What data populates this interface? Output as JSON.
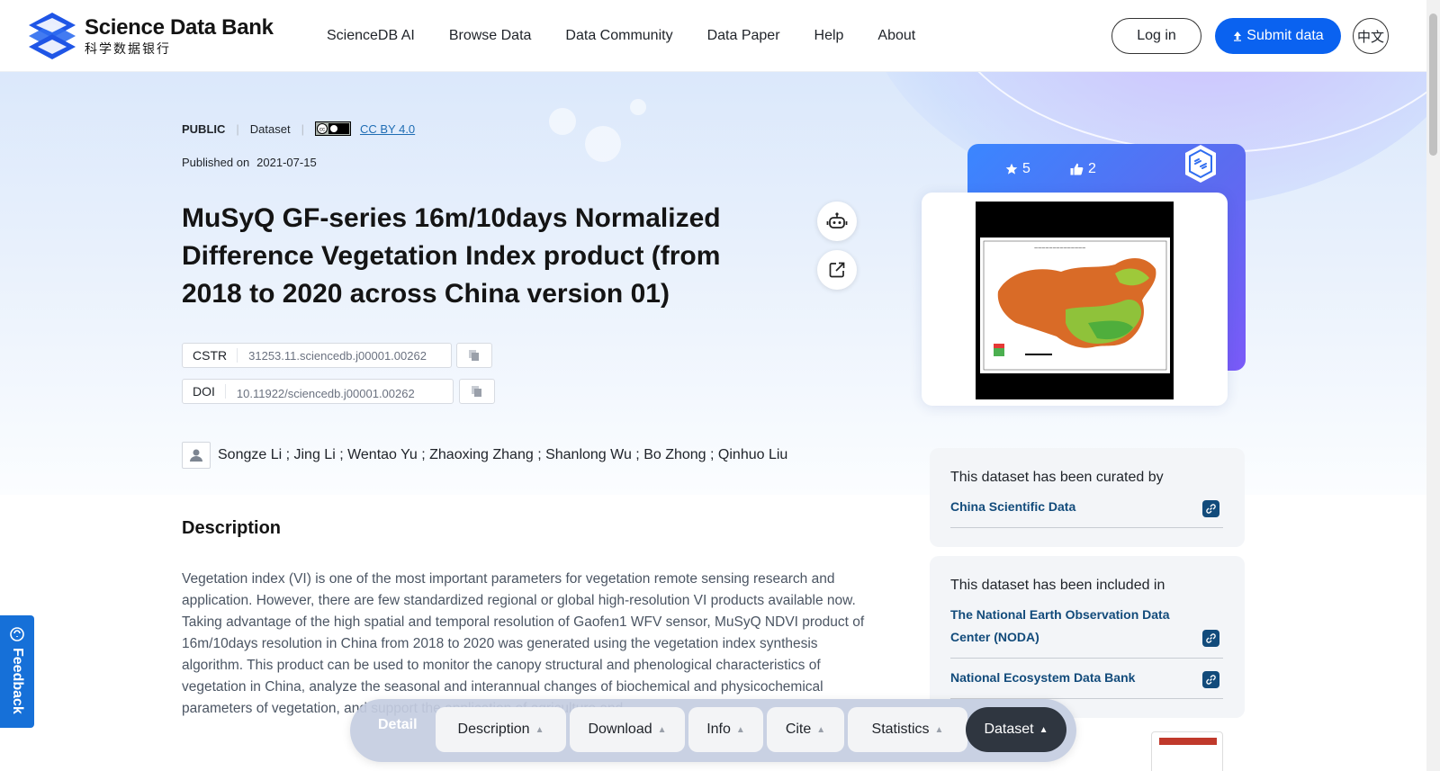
{
  "header": {
    "logo_en": "Science Data Bank",
    "logo_zh": "科学数据银行",
    "nav": [
      "ScienceDB AI",
      "Browse Data",
      "Data Community",
      "Data Paper",
      "Help",
      "About"
    ],
    "login_label": "Log in",
    "submit_label": "Submit data",
    "lang_label": "中文"
  },
  "dataset": {
    "visibility": "PUBLIC",
    "type": "Dataset",
    "license": "CC BY 4.0",
    "published_label": "Published on",
    "published_date": "2021-07-15",
    "title": "MuSyQ GF-series 16m/10days Normalized Difference Vegetation Index product (from 2018 to 2020 across China version 01)",
    "cstr_label": "CSTR",
    "cstr_value": "31253.11.sciencedb.j00001.00262",
    "doi_label": "DOI",
    "doi_value": "10.11922/sciencedb.j00001.00262",
    "authors": "Songze Li ; Jing Li ; Wentao Yu ; Zhaoxing Zhang ; Shanlong Wu ; Bo Zhong ; Qinhuo Liu",
    "stars": "5",
    "likes": "2"
  },
  "description": {
    "heading": "Description",
    "text": "Vegetation index (VI) is one of the most important parameters for vegetation remote sensing research and application. However, there are few standardized regional or global high-resolution VI products available now. Taking advantage of the high spatial and temporal resolution of Gaofen1 WFV sensor, MuSyQ NDVI product of 16m/10days resolution in China from 2018 to 2020 was generated using the vegetation index synthesis algorithm. This product can be used to monitor the canopy structural and phenological characteristics of vegetation in China, analyze the seasonal and interannual changes of biochemical and physicochemical parameters of vegetation, and support the application of agriculture and"
  },
  "curated": {
    "heading": "This dataset has been curated by",
    "items": [
      "China Scientific Data"
    ]
  },
  "included": {
    "heading": "This dataset has been included in",
    "items": [
      "The National Earth Observation Data Center (NODA)",
      "National Ecosystem Data Bank"
    ]
  },
  "feedback_label": "Feedback",
  "bottom_bar": {
    "detail": "Detail",
    "tabs": [
      "Description",
      "Download",
      "Info",
      "Cite",
      "Statistics",
      "Dataset"
    ]
  },
  "colors": {
    "brand": "#0a62f0",
    "link": "#124b7b",
    "feedback": "#1670d8"
  }
}
